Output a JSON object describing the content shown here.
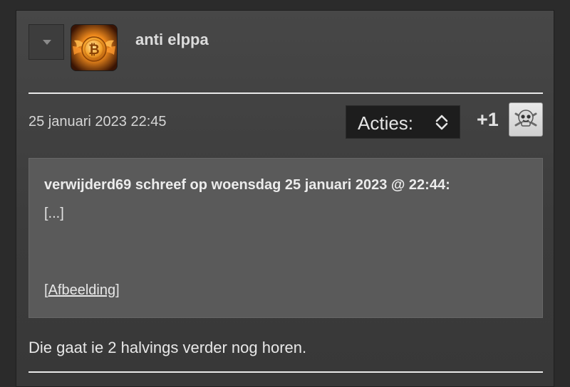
{
  "post": {
    "author": "anti elppa",
    "avatar_icon": "bitcoin-logo-icon",
    "collapse_icon": "caret-down-icon",
    "timestamp": "25 januari 2023 22:45",
    "actions": {
      "label": "Acties:",
      "icon": "up-down-chevron-icon"
    },
    "score": "+1",
    "vote_icon": "skull-smiley-icon",
    "quote": {
      "header": "verwijderd69 schreef op woensdag 25 januari 2023 @ 22:44:",
      "ellipsis": "[...]",
      "image_open": "[",
      "image_link": "Afbeelding",
      "image_close": "]"
    },
    "message": "Die gaat ie 2 halvings verder nog horen."
  },
  "colors": {
    "background": "#2b2b2b",
    "card": "#474747",
    "quote_box": "#5a5a5a",
    "select_bg": "#1d1d1d",
    "text": "#e6e6e6"
  }
}
